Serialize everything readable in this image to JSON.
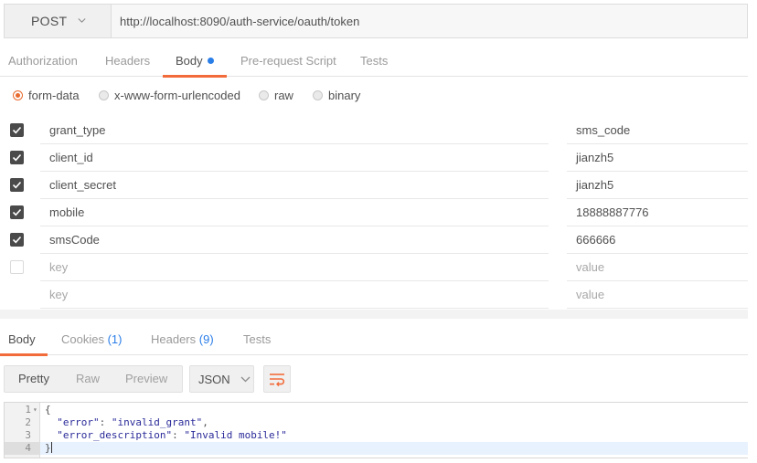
{
  "request": {
    "method": "POST",
    "url": "http://localhost:8090/auth-service/oauth/token"
  },
  "request_tabs": [
    {
      "label": "Authorization",
      "active": false
    },
    {
      "label": "Headers",
      "active": false
    },
    {
      "label": "Body",
      "active": true,
      "indicator": true
    },
    {
      "label": "Pre-request Script",
      "active": false
    },
    {
      "label": "Tests",
      "active": false
    }
  ],
  "body_types": [
    {
      "label": "form-data",
      "selected": true
    },
    {
      "label": "x-www-form-urlencoded",
      "selected": false
    },
    {
      "label": "raw",
      "selected": false
    },
    {
      "label": "binary",
      "selected": false
    }
  ],
  "params": [
    {
      "checked": true,
      "key": "grant_type",
      "value": "sms_code"
    },
    {
      "checked": true,
      "key": "client_id",
      "value": "jianzh5"
    },
    {
      "checked": true,
      "key": "client_secret",
      "value": "jianzh5"
    },
    {
      "checked": true,
      "key": "mobile",
      "value": "18888887776"
    },
    {
      "checked": true,
      "key": "smsCode",
      "value": "666666"
    }
  ],
  "param_placeholders": {
    "key": "key",
    "value": "value"
  },
  "response_tabs": {
    "body": "Body",
    "cookies": "Cookies",
    "cookies_count": "(1)",
    "headers": "Headers",
    "headers_count": "(9)",
    "tests": "Tests"
  },
  "response_toolbar": {
    "view_modes": [
      "Pretty",
      "Raw",
      "Preview"
    ],
    "selected_view": "Pretty",
    "format": "JSON",
    "wrap_icon": "wrap-lines-icon"
  },
  "response_code": {
    "line_numbers": [
      "1",
      "2",
      "3",
      "4"
    ],
    "open_brace": "{",
    "error_key": "\"error\"",
    "error_value": "\"invalid_grant\"",
    "desc_key": "\"error_description\"",
    "desc_value": "\"Invalid mobile!\"",
    "close_brace": "}"
  },
  "colors": {
    "accent": "#f26b3a",
    "link_blue": "#2a7ee8"
  }
}
